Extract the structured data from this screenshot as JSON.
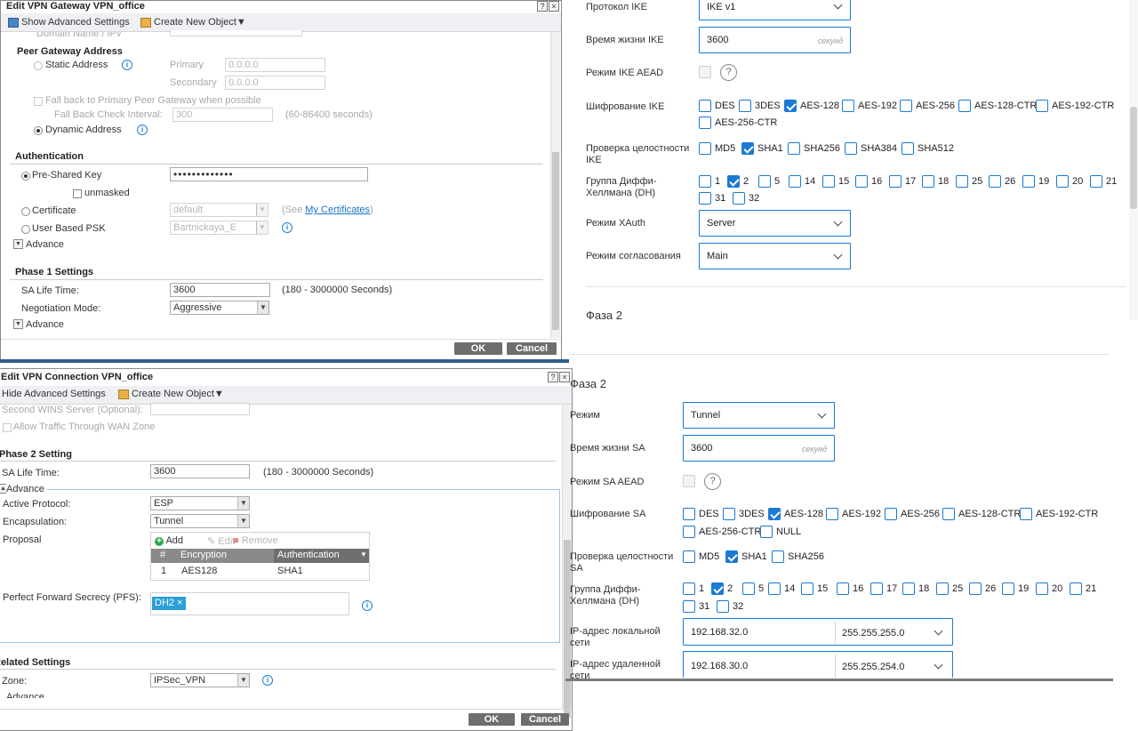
{
  "gateway": {
    "title": "Edit VPN Gateway VPN_office",
    "toolbar": {
      "advanced": "Show Advanced Settings",
      "create": "Create New Object▼"
    },
    "domain_cut": "Domain Name / IPv",
    "peer_gateway": {
      "heading": "Peer Gateway Address",
      "static": "Static Address",
      "primary": "Primary",
      "primary_val": "0.0.0.0",
      "secondary": "Secondary",
      "secondary_val": "0.0.0.0",
      "fallback": "Fall back to Primary Peer Gateway when possible",
      "fallback_interval": "Fall Back Check Interval:",
      "fallback_val": "300",
      "fallback_range": "(60-86400 seconds)",
      "dynamic": "Dynamic Address"
    },
    "auth": {
      "heading": "Authentication",
      "psk": "Pre-Shared Key",
      "psk_val": "•••••••••••••",
      "unmasked": "unmasked",
      "certificate": "Certificate",
      "cert_val": "default",
      "cert_hint_pre": "(See ",
      "cert_hint_link": "My Certificates",
      "cert_hint_post": ")",
      "user_psk": "User Based PSK",
      "user_psk_val": "Bartnickaya_E",
      "advance": "Advance"
    },
    "phase1": {
      "heading": "Phase 1 Settings",
      "sa_life": "SA Life Time:",
      "sa_life_val": "3600",
      "sa_range": "(180 - 3000000 Seconds)",
      "neg_mode": "Negotiation Mode:",
      "neg_val": "Aggressive",
      "advance": "Advance"
    },
    "buttons": {
      "ok": "OK",
      "cancel": "Cancel"
    }
  },
  "connection": {
    "title": "Edit VPN Connection VPN_office",
    "toolbar": {
      "advanced": "Hide Advanced Settings",
      "create": "Create New Object▼"
    },
    "wins": "Second WINS Server (Optional):",
    "allow": "Allow Traffic Through WAN Zone",
    "phase2": {
      "heading": "Phase 2 Setting",
      "sa_life": "SA Life Time:",
      "sa_life_val": "3600",
      "sa_range": "(180 - 3000000 Seconds)",
      "advance": "Advance",
      "protocol": "Active Protocol:",
      "protocol_val": "ESP",
      "encap": "Encapsulation:",
      "encap_val": "Tunnel",
      "proposal": "Proposal",
      "add": "Add",
      "edit": "Edit",
      "remove": "Remove",
      "cols": [
        "#",
        "Encryption",
        "Authentication"
      ],
      "rows": [
        [
          "1",
          "AES128",
          "SHA1"
        ]
      ],
      "pfs": "Perfect Forward Secrecy (PFS):",
      "pfs_tag": "DH2 ×"
    },
    "related": {
      "heading": "Related Settings",
      "zone": "Zone:",
      "zone_val": "IPSec_VPN",
      "advance": "Advance"
    },
    "buttons": {
      "ok": "OK",
      "cancel": "Cancel"
    }
  },
  "ike": {
    "protocol_label": "Протокол IKE",
    "protocol_val": "IKE v1",
    "lifetime_label": "Время жизни IKE",
    "lifetime_val": "3600",
    "lifetime_unit": "секунд",
    "aead_label": "Режим IKE AEAD",
    "enc_label": "Шифрование IKE",
    "enc": [
      {
        "label": "DES",
        "on": false
      },
      {
        "label": "3DES",
        "on": false
      },
      {
        "label": "AES-128",
        "on": true
      },
      {
        "label": "AES-192",
        "on": false
      },
      {
        "label": "AES-256",
        "on": false
      },
      {
        "label": "AES-128-CTR",
        "on": false
      },
      {
        "label": "AES-192-CTR",
        "on": false
      },
      {
        "label": "AES-256-CTR",
        "on": false
      }
    ],
    "integrity_label_1": "Проверка целостности",
    "integrity_label_2": "IKE",
    "integrity": [
      {
        "label": "MD5",
        "on": false
      },
      {
        "label": "SHA1",
        "on": true
      },
      {
        "label": "SHA256",
        "on": false
      },
      {
        "label": "SHA384",
        "on": false
      },
      {
        "label": "SHA512",
        "on": false
      }
    ],
    "dh_label_1": "Группа Диффи-",
    "dh_label_2": "Хеллмана (DH)",
    "dh": [
      "1",
      "2",
      "5",
      "14",
      "15",
      "16",
      "17",
      "18",
      "25",
      "26",
      "19",
      "20",
      "21",
      "31",
      "32"
    ],
    "dh_checked": "2",
    "xauth_label": "Режим XAuth",
    "xauth_val": "Server",
    "neg_label": "Режим согласования",
    "neg_val": "Main",
    "phase2_heading": "Фаза 2"
  },
  "sa": {
    "heading": "Фаза 2",
    "mode_label": "Режим",
    "mode_val": "Tunnel",
    "lifetime_label": "Время жизни SA",
    "lifetime_val": "3600",
    "lifetime_unit": "секунд",
    "aead_label": "Режим SA AEAD",
    "enc_label": "Шифрование SA",
    "enc": [
      {
        "label": "DES",
        "on": false
      },
      {
        "label": "3DES",
        "on": false
      },
      {
        "label": "AES-128",
        "on": true
      },
      {
        "label": "AES-192",
        "on": false
      },
      {
        "label": "AES-256",
        "on": false
      },
      {
        "label": "AES-128-CTR",
        "on": false
      },
      {
        "label": "AES-192-CTR",
        "on": false
      },
      {
        "label": "AES-256-CTR",
        "on": false
      },
      {
        "label": "NULL",
        "on": false
      }
    ],
    "integrity_label_1": "Проверка целостности",
    "integrity_label_2": "SA",
    "integrity": [
      {
        "label": "MD5",
        "on": false
      },
      {
        "label": "SHA1",
        "on": true
      },
      {
        "label": "SHA256",
        "on": false
      }
    ],
    "dh_label_1": "Группа Диффи-",
    "dh_label_2": "Хеллмана (DH)",
    "dh": [
      "1",
      "2",
      "5",
      "14",
      "15",
      "16",
      "17",
      "18",
      "25",
      "26",
      "19",
      "20",
      "21",
      "31",
      "32"
    ],
    "dh_checked": "2",
    "local_label_1": "IP-адрес локальной",
    "local_label_2": "сети",
    "local_ip": "192.168.32.0",
    "local_mask": "255.255.255.0",
    "remote_label_1": "IP-адрес удаленной",
    "remote_label_2": "сети",
    "remote_ip": "192.168.30.0",
    "remote_mask": "255.255.254.0"
  },
  "colors": {
    "accent": "#1a7ad4",
    "zyxel_button": "#6e6e6e",
    "info": "#1d7fd0"
  }
}
